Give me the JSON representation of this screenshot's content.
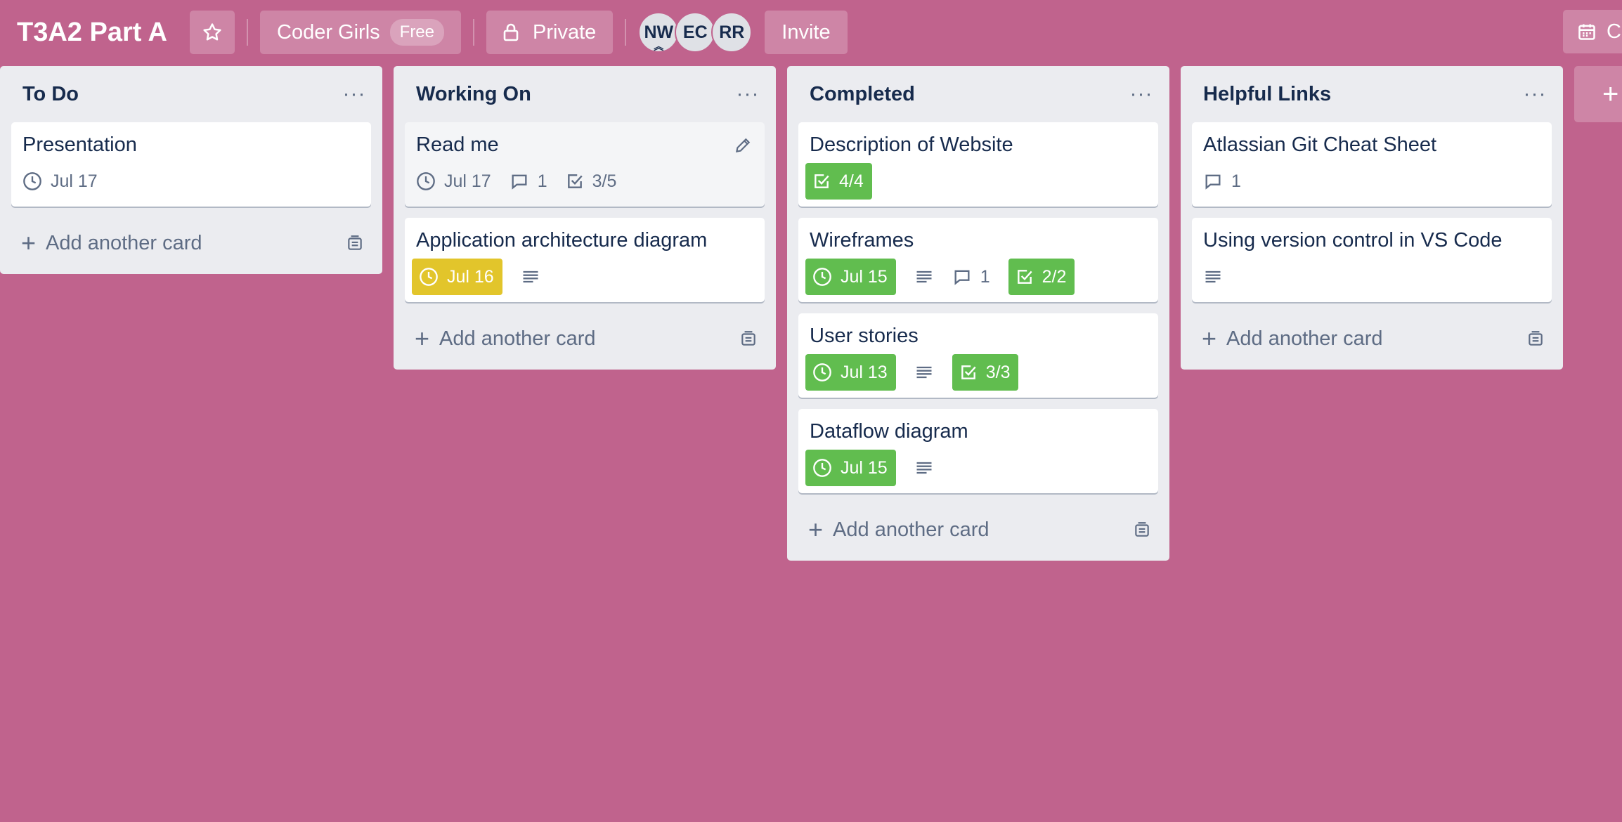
{
  "header": {
    "board_title": "T3A2 Part A",
    "workspace_name": "Coder Girls",
    "workspace_plan": "Free",
    "visibility": "Private",
    "members": [
      {
        "initials": "NW"
      },
      {
        "initials": "EC"
      },
      {
        "initials": "RR"
      }
    ],
    "invite_label": "Invite",
    "calendar_label": "C"
  },
  "colors": {
    "background": "#c0638d",
    "due_yellow": "#e2c52b",
    "due_green": "#61bd4f",
    "list_bg": "#ebecf0"
  },
  "lists": [
    {
      "title": "To Do",
      "cards": [
        {
          "title": "Presentation",
          "due": "Jul 17"
        }
      ],
      "add_label": "Add another card"
    },
    {
      "title": "Working On",
      "cards": [
        {
          "title": "Read me",
          "due": "Jul 17",
          "comments": "1",
          "checklist": "3/5"
        },
        {
          "title": "Application architecture diagram",
          "due": "Jul 16"
        }
      ],
      "add_label": "Add another card"
    },
    {
      "title": "Completed",
      "cards": [
        {
          "title": "Description of Website",
          "checklist": "4/4"
        },
        {
          "title": "Wireframes",
          "due": "Jul 15",
          "comments": "1",
          "checklist": "2/2"
        },
        {
          "title": "User stories",
          "due": "Jul 13",
          "checklist": "3/3"
        },
        {
          "title": "Dataflow diagram",
          "due": "Jul 15"
        }
      ],
      "add_label": "Add another card"
    },
    {
      "title": "Helpful Links",
      "cards": [
        {
          "title": "Atlassian Git Cheat Sheet",
          "comments": "1"
        },
        {
          "title": "Using version control in VS Code"
        }
      ],
      "add_label": "Add another card"
    }
  ],
  "add_list_label": "+"
}
